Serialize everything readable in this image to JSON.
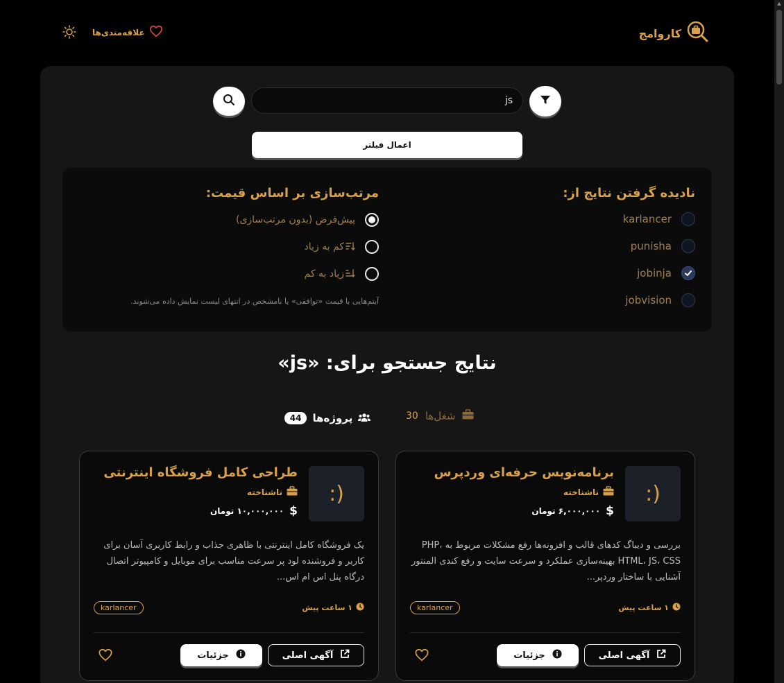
{
  "header": {
    "logo_text": "کاروامج",
    "favorites_label": "علاقه‌مندی‌ها"
  },
  "search": {
    "value": "js",
    "apply_label": "اعمال فیلتر"
  },
  "filters": {
    "ignore_title": "نادیده گرفتن نتایج از:",
    "sources": [
      {
        "label": "karlancer",
        "checked": false
      },
      {
        "label": "punisha",
        "checked": false
      },
      {
        "label": "jobinja",
        "checked": true
      },
      {
        "label": "jobvision",
        "checked": false
      }
    ],
    "sort_title": "مرتب‌سازی بر اساس قیمت:",
    "sort_options": [
      {
        "label": "پیش‌فرض (بدون مرتب‌سازی)",
        "selected": true
      },
      {
        "label": "کم به زیاد",
        "selected": false
      },
      {
        "label": "زیاد به کم",
        "selected": false
      }
    ],
    "sort_note": "آیتم‌هایی با قیمت «توافقی» یا نامشخص در انتهای لیست نمایش داده می‌شوند."
  },
  "results": {
    "title": "نتایج جستجو برای: «js»",
    "tabs": [
      {
        "label": "پروژه‌ها",
        "count": "44",
        "active": true
      },
      {
        "label": "شغل‌ها",
        "count": "30",
        "active": false
      }
    ]
  },
  "cards": [
    {
      "image_text": ":)",
      "title": "برنامه‌نویس حرفه‌ای وردپرس",
      "company": "ناشناخته",
      "price": "۶,۰۰۰,۰۰۰ تومان",
      "description": "بررسی و دیباگ کدهای قالب و افزونه‌ها رفع مشکلات مربوط به PHP، HTML، JS، CSS بهینه‌سازی عملکرد و سرعت سایت و رفع کندی المنتور آشنایی با ساختار وردپر...",
      "time": "۱ ساعت پیش",
      "tag": "karlancer",
      "original_label": "آگهی اصلی",
      "details_label": "جزئیات"
    },
    {
      "image_text": ":)",
      "title": "طراحی کامل فروشگاه اینترنتی",
      "company": "ناشناخته",
      "price": "۱۰,۰۰۰,۰۰۰ تومان",
      "description": "یک فروشگاه کامل اینترنتی با ظاهری جذاب و رابط کاربری آسان برای کاربر و فروشنده لود پر سرعت مناسب برای موبایل و کامپیوتر اتصال درگاه پنل اس ام اس...",
      "time": "۱ ساعت پیش",
      "tag": "karlancer",
      "original_label": "آگهی اصلی",
      "details_label": "جزئیات"
    }
  ],
  "colors": {
    "accent": "#d9a24a",
    "background": "#000000",
    "panel": "#161616"
  }
}
